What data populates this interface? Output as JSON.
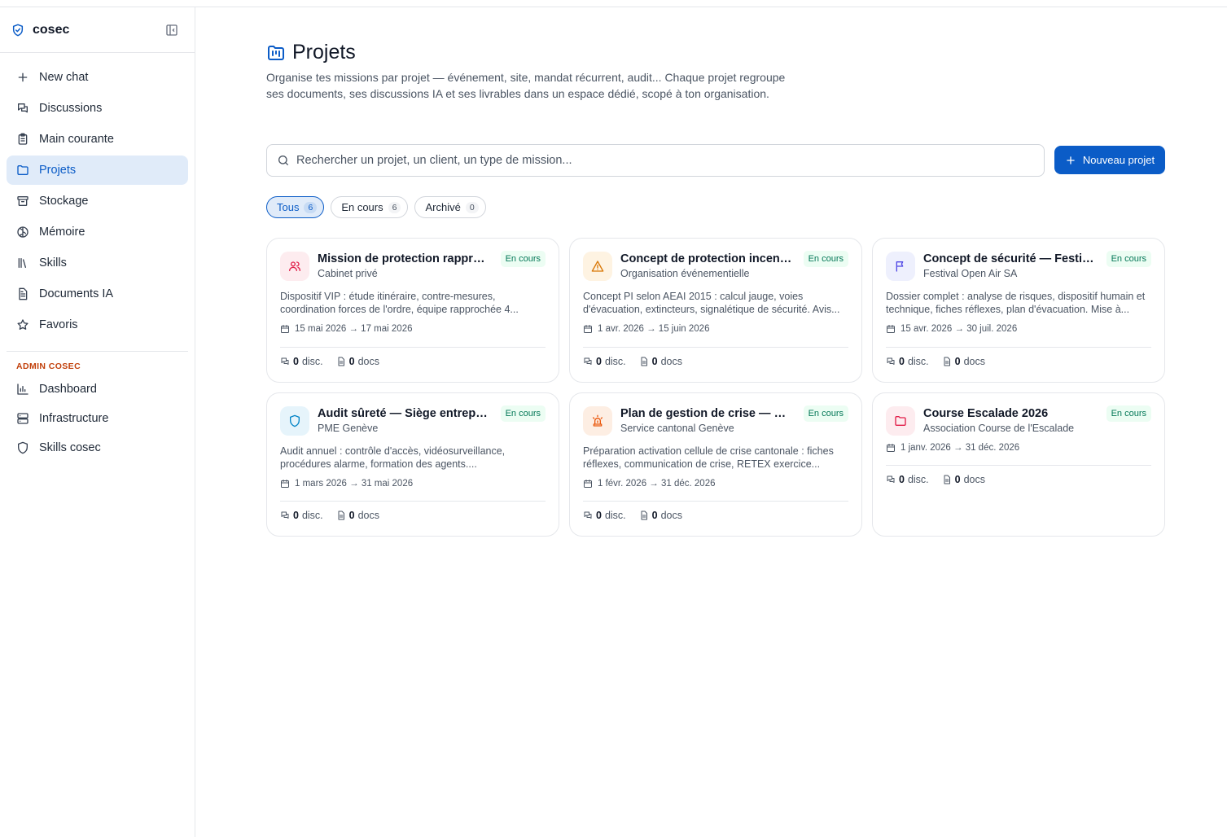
{
  "app": {
    "name": "cosec"
  },
  "sidebar": {
    "items": [
      {
        "label": "New chat",
        "icon": "plus-icon"
      },
      {
        "label": "Discussions",
        "icon": "chat-icon"
      },
      {
        "label": "Main courante",
        "icon": "clipboard-icon"
      },
      {
        "label": "Projets",
        "icon": "folder-icon",
        "active": true
      },
      {
        "label": "Stockage",
        "icon": "archive-icon"
      },
      {
        "label": "Mémoire",
        "icon": "brain-icon"
      },
      {
        "label": "Skills",
        "icon": "library-icon"
      },
      {
        "label": "Documents IA",
        "icon": "document-icon"
      },
      {
        "label": "Favoris",
        "icon": "star-icon"
      }
    ],
    "admin_section": "ADMIN COSEC",
    "admin_items": [
      {
        "label": "Dashboard",
        "icon": "bar-chart-icon"
      },
      {
        "label": "Infrastructure",
        "icon": "server-icon"
      },
      {
        "label": "Skills cosec",
        "icon": "shield-icon"
      }
    ]
  },
  "page": {
    "title": "Projets",
    "subtitle": "Organise tes missions par projet — événement, site, mandat récurrent, audit... Chaque projet regroupe ses documents, ses discussions IA et ses livrables dans un espace dédié, scopé à ton organisation.",
    "search_placeholder": "Rechercher un projet, un client, un type de mission...",
    "new_button": "Nouveau projet"
  },
  "filters": [
    {
      "label": "Tous",
      "count": "6",
      "active": true
    },
    {
      "label": "En cours",
      "count": "6"
    },
    {
      "label": "Archivé",
      "count": "0"
    }
  ],
  "projects": [
    {
      "title": "Mission de protection rapprochée",
      "client": "Cabinet privé",
      "status": "En cours",
      "description": "Dispositif VIP : étude itinéraire, contre-mesures, coordination forces de l'ordre, équipe rapprochée 4...",
      "dates": "15 mai 2026 → 17 mai 2026",
      "discussions": "0",
      "disc_label": "disc.",
      "docs": "0",
      "docs_label": "docs",
      "icon": "users-icon",
      "icon_color": "#e11d48",
      "icon_bg": "#fdecef"
    },
    {
      "title": "Concept de protection incendie",
      "client": "Organisation événementielle",
      "status": "En cours",
      "description": "Concept PI selon AEAI 2015 : calcul jauge, voies d'évacuation, extincteurs, signalétique de sécurité. Avis...",
      "dates": "1 avr. 2026 → 15 juin 2026",
      "discussions": "0",
      "disc_label": "disc.",
      "docs": "0",
      "docs_label": "docs",
      "icon": "warning-icon",
      "icon_color": "#d97706",
      "icon_bg": "#fef3e2"
    },
    {
      "title": "Concept de sécurité — Festival Open Air",
      "client": "Festival Open Air SA",
      "status": "En cours",
      "description": "Dossier complet : analyse de risques, dispositif humain et technique, fiches réflexes, plan d'évacuation. Mise à...",
      "dates": "15 avr. 2026 → 30 juil. 2026",
      "discussions": "0",
      "disc_label": "disc.",
      "docs": "0",
      "docs_label": "docs",
      "icon": "flag-icon",
      "icon_color": "#4f46e5",
      "icon_bg": "#eef0fd"
    },
    {
      "title": "Audit sûreté — Siège entreprise",
      "client": "PME Genève",
      "status": "En cours",
      "description": "Audit annuel : contrôle d'accès, vidéosurveillance, procédures alarme, formation des agents....",
      "dates": "1 mars 2026 → 31 mai 2026",
      "discussions": "0",
      "disc_label": "disc.",
      "docs": "0",
      "docs_label": "docs",
      "icon": "shield-icon",
      "icon_color": "#0284c7",
      "icon_bg": "#e6f4fb"
    },
    {
      "title": "Plan de gestion de crise — Plan ORCA",
      "client": "Service cantonal Genève",
      "status": "En cours",
      "description": "Préparation activation cellule de crise cantonale : fiches réflexes, communication de crise, RETEX exercice...",
      "dates": "1 févr. 2026 → 31 déc. 2026",
      "discussions": "0",
      "disc_label": "disc.",
      "docs": "0",
      "docs_label": "docs",
      "icon": "siren-icon",
      "icon_color": "#ea580c",
      "icon_bg": "#fdeee3"
    },
    {
      "title": "Course Escalade 2026",
      "client": "Association Course de l'Escalade",
      "status": "En cours",
      "description": "",
      "dates": "1 janv. 2026 → 31 déc. 2026",
      "discussions": "0",
      "disc_label": "disc.",
      "docs": "0",
      "docs_label": "docs",
      "icon": "folder-icon",
      "icon_color": "#e11d48",
      "icon_bg": "#fdecef"
    }
  ]
}
